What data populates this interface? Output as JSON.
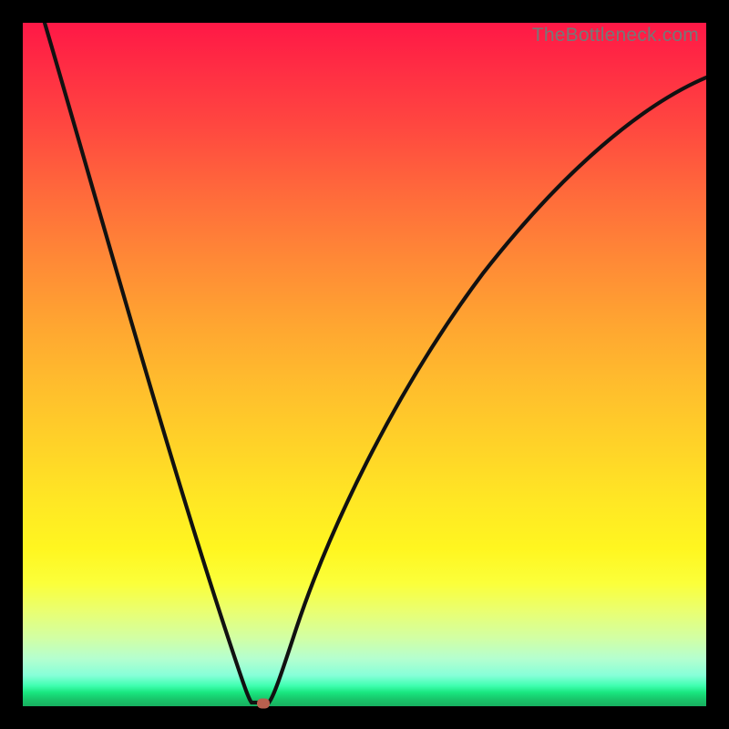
{
  "watermark": "TheBottleneck.com",
  "colors": {
    "frame_border": "#000000",
    "curve_stroke": "#111111",
    "marker_fill": "#b8604e",
    "gradient_top": "#ff1846",
    "gradient_bottom": "#17b060"
  },
  "marker": {
    "x_frac": 0.353,
    "y_frac": 0.997
  },
  "chart_data": {
    "type": "line",
    "title": "",
    "xlabel": "",
    "ylabel": "",
    "xlim": [
      0,
      1
    ],
    "ylim": [
      0,
      1
    ],
    "series": [
      {
        "name": "bottleneck-curve",
        "x": [
          0.0,
          0.05,
          0.1,
          0.15,
          0.2,
          0.25,
          0.3,
          0.325,
          0.345,
          0.36,
          0.375,
          0.4,
          0.45,
          0.5,
          0.55,
          0.6,
          0.65,
          0.7,
          0.75,
          0.8,
          0.85,
          0.9,
          0.95,
          1.0
        ],
        "y": [
          1.0,
          0.85,
          0.7,
          0.56,
          0.42,
          0.28,
          0.13,
          0.04,
          0.005,
          0.005,
          0.02,
          0.11,
          0.27,
          0.4,
          0.5,
          0.58,
          0.65,
          0.71,
          0.76,
          0.8,
          0.83,
          0.86,
          0.88,
          0.9
        ]
      }
    ],
    "annotations": [
      {
        "type": "marker",
        "x": 0.353,
        "y": 0.003
      }
    ]
  }
}
